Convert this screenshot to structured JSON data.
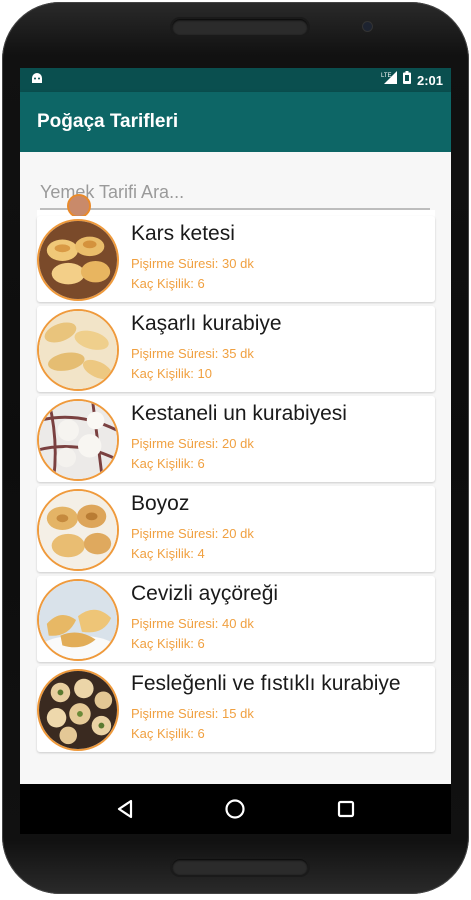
{
  "status": {
    "time": "2:01"
  },
  "app": {
    "title": "Poğaça Tarifleri"
  },
  "search": {
    "placeholder": "Yemek Tarifi Ara..."
  },
  "recipes": [
    {
      "title": "Kars ketesi",
      "time": "Pişirme Süresi: 30 dk",
      "servings": "Kaç Kişilik: 6",
      "image": "kars-ketesi-photo"
    },
    {
      "title": "Kaşarlı kurabiye",
      "time": "Pişirme Süresi: 35 dk",
      "servings": "Kaç Kişilik: 10",
      "image": "kasarli-kurabiye-photo"
    },
    {
      "title": "Kestaneli un kurabiyesi",
      "time": "Pişirme Süresi: 20 dk",
      "servings": "Kaç Kişilik: 6",
      "image": "kestaneli-kurabiye-photo"
    },
    {
      "title": "Boyoz",
      "time": "Pişirme Süresi: 20 dk",
      "servings": "Kaç Kişilik: 4",
      "image": "boyoz-photo"
    },
    {
      "title": "Cevizli ayçöreği",
      "time": "Pişirme Süresi: 40 dk",
      "servings": "Kaç Kişilik: 6",
      "image": "cevizli-aycoregi-photo"
    },
    {
      "title": "Fesleğenli ve fıstıklı kurabiye",
      "time": "Pişirme Süresi: 15 dk",
      "servings": "Kaç Kişilik: 6",
      "image": "feslegenli-kurabiye-photo"
    }
  ],
  "icons": {
    "status_left": "android-icon",
    "status_right": [
      "lte-signal-icon",
      "battery-icon"
    ],
    "nav": [
      "back-icon",
      "home-icon",
      "recents-icon"
    ]
  },
  "colors": {
    "status_bar": "#0a4f4f",
    "app_bar": "#0d6666",
    "meta_text": "#f0a040",
    "thumb_border": "#ef9a3c"
  }
}
